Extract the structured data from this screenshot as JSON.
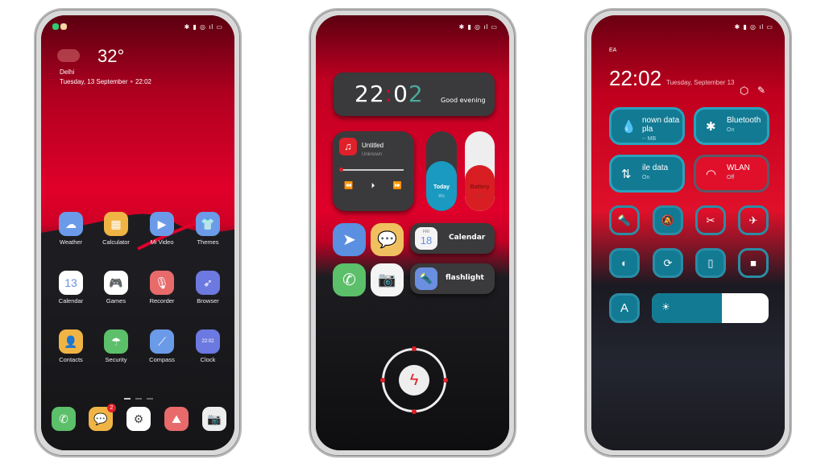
{
  "home": {
    "weather": {
      "temp": "32°",
      "city": "Delhi",
      "datetime": "Tuesday, 13 September ∘ 22:02"
    },
    "apps": [
      {
        "label": "Weather",
        "color": "#6b9be8",
        "icon": "☁"
      },
      {
        "label": "Calculator",
        "color": "#f0b445",
        "icon": "▦"
      },
      {
        "label": "Mi Video",
        "color": "#6b9be8",
        "icon": "▶"
      },
      {
        "label": "Themes",
        "color": "#6b9be8",
        "icon": "👕"
      },
      {
        "label": "Calendar",
        "color": "#ffffff",
        "icon": "13"
      },
      {
        "label": "Games",
        "color": "#ffffff",
        "icon": "🎮"
      },
      {
        "label": "Recorder",
        "color": "#e86a6a",
        "icon": "🎙"
      },
      {
        "label": "Browser",
        "color": "#6b79e0",
        "icon": "➶"
      },
      {
        "label": "Contacts",
        "color": "#f0b445",
        "icon": "👤"
      },
      {
        "label": "Security",
        "color": "#5cbf6a",
        "icon": "☂"
      },
      {
        "label": "Compass",
        "color": "#6b9be8",
        "icon": "⟋"
      },
      {
        "label": "Clock",
        "color": "#6b79e0",
        "icon": "22:02"
      }
    ],
    "dock": [
      {
        "name": "phone",
        "color": "#5cbf6a",
        "icon": "✆"
      },
      {
        "name": "messages",
        "color": "#f0b445",
        "icon": "💬",
        "badge": "2"
      },
      {
        "name": "settings",
        "color": "#ffffff",
        "icon": "⚙"
      },
      {
        "name": "gallery",
        "color": "#e86a6a",
        "icon": "⛰"
      },
      {
        "name": "camera",
        "color": "#eeeeee",
        "icon": "📷"
      }
    ]
  },
  "widgets": {
    "clock": {
      "h": "22",
      "m1": "0",
      "m2": "2",
      "greeting": "Good evening"
    },
    "music": {
      "title": "Untitled",
      "artist": "Unknown"
    },
    "today": {
      "label": "Today",
      "value": "6%"
    },
    "battery": {
      "label": "Battery",
      "value": "56%"
    },
    "calendar_pill": {
      "day": "FRI",
      "date": "18",
      "label": "Calendar"
    },
    "flashlight_pill": {
      "label": "flashlight"
    }
  },
  "control": {
    "carrier": "EA",
    "time": "22:02",
    "date": "Tuesday, September 13",
    "tiles": [
      {
        "title": "nown data pla",
        "sub": "-- MB",
        "icon": "💧",
        "active": true
      },
      {
        "title": "Bluetooth",
        "sub": "On",
        "icon": "✱",
        "active": true
      },
      {
        "title": "ile data",
        "sub": "On",
        "icon": "⇅",
        "active": true
      },
      {
        "title": "WLAN",
        "sub": "Off",
        "icon": "◠",
        "active": false
      }
    ],
    "buttons": [
      {
        "name": "flashlight",
        "icon": "🔦",
        "active": false
      },
      {
        "name": "mute",
        "icon": "🔕",
        "active": true
      },
      {
        "name": "screenshot",
        "icon": "✂",
        "active": false
      },
      {
        "name": "airplane",
        "icon": "✈",
        "active": false
      },
      {
        "name": "toggle",
        "icon": "◐",
        "active": true
      },
      {
        "name": "auto-rotate",
        "icon": "⟳",
        "active": true
      },
      {
        "name": "vibrate",
        "icon": "▯",
        "active": true
      },
      {
        "name": "screen-record",
        "icon": "■",
        "active": false
      }
    ],
    "auto_brightness": "A",
    "brightness_percent": 60,
    "accent": "#127a93"
  }
}
